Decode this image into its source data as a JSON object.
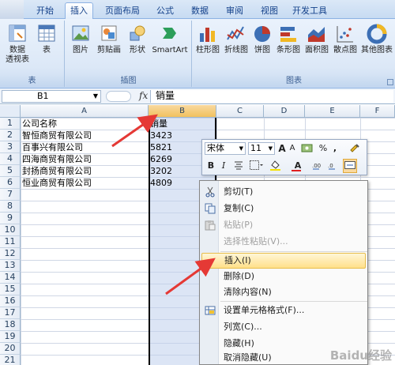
{
  "ribbon": {
    "tabs": [
      "开始",
      "插入",
      "页面布局",
      "公式",
      "数据",
      "审阅",
      "视图",
      "开发工具"
    ],
    "active_tab": "插入",
    "groups": {
      "table": {
        "label": "表",
        "buttons": [
          "数据\n透视表",
          "表"
        ]
      },
      "illustrations": {
        "label": "插图",
        "buttons": [
          "图片",
          "剪贴画",
          "形状",
          "SmartArt"
        ]
      },
      "charts": {
        "label": "图表",
        "buttons": [
          "柱形图",
          "折线图",
          "饼图",
          "条形图",
          "面积图",
          "散点图",
          "其他图表"
        ]
      }
    }
  },
  "formula_bar": {
    "name_box": "B1",
    "fx": "fx",
    "content": "销量"
  },
  "sheet": {
    "columns": [
      "A",
      "B",
      "C",
      "D",
      "E",
      "F"
    ],
    "selected_column": "B",
    "rows": [
      "1",
      "2",
      "3",
      "4",
      "5",
      "6",
      "7",
      "8",
      "9",
      "10",
      "11",
      "12",
      "13",
      "14",
      "15",
      "16",
      "17",
      "18",
      "19",
      "20",
      "21"
    ],
    "cells": [
      [
        "公司名称",
        "销量"
      ],
      [
        "智恒商贸有限公司",
        "3423"
      ],
      [
        "百事兴有限公司",
        "5821"
      ],
      [
        "四海商贸有限公司",
        "6269"
      ],
      [
        "封扬商贸有限公司",
        "3202"
      ],
      [
        "恒业商贸有限公司",
        "4809"
      ]
    ]
  },
  "mini_toolbar": {
    "font": "宋体",
    "size": "11",
    "buttons": [
      "A",
      "A",
      "%",
      ",",
      "B",
      "I",
      "A"
    ]
  },
  "context_menu": {
    "items": [
      {
        "label": "剪切(T)",
        "icon": "scissors-icon",
        "state": "normal"
      },
      {
        "label": "复制(C)",
        "icon": "copy-icon",
        "state": "normal"
      },
      {
        "label": "粘贴(P)",
        "icon": "paste-icon",
        "state": "disabled"
      },
      {
        "label": "选择性粘贴(V)...",
        "icon": "",
        "state": "disabled"
      },
      {
        "label": "插入(I)",
        "icon": "",
        "state": "highlighted"
      },
      {
        "label": "删除(D)",
        "icon": "",
        "state": "normal"
      },
      {
        "label": "清除内容(N)",
        "icon": "",
        "state": "normal"
      },
      {
        "label": "设置单元格格式(F)...",
        "icon": "format-cells-icon",
        "state": "normal"
      },
      {
        "label": "列宽(C)...",
        "icon": "",
        "state": "normal"
      },
      {
        "label": "隐藏(H)",
        "icon": "",
        "state": "normal"
      },
      {
        "label": "取消隐藏(U)",
        "icon": "",
        "state": "normal"
      }
    ]
  },
  "watermark": "Baidu经验",
  "colors": {
    "accent_arrow": "#e53935",
    "ribbon_blue": "#c7dbf2",
    "selection_border": "#000000"
  }
}
